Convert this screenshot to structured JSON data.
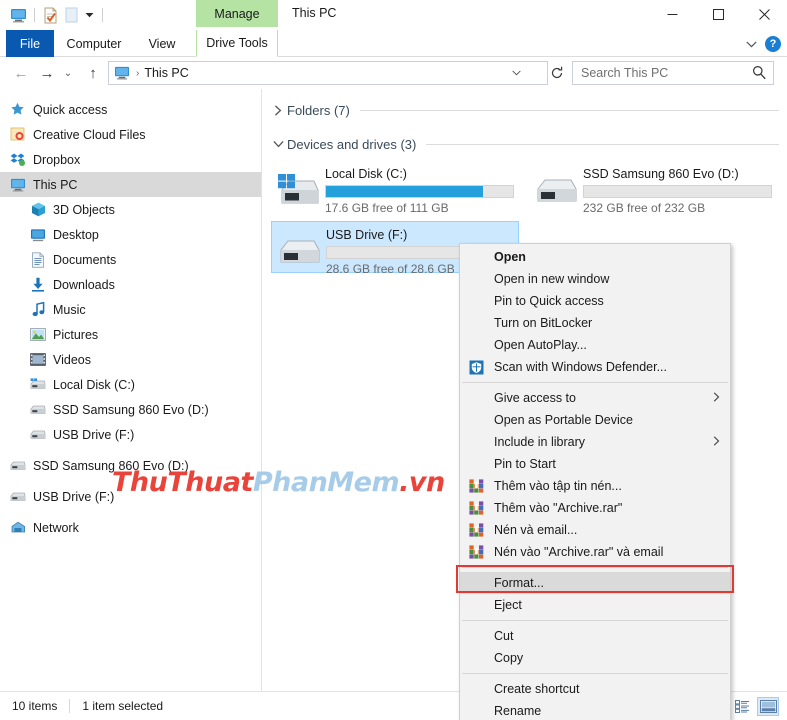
{
  "window": {
    "title": "This PC",
    "contextual_tab_group": "Manage",
    "quick_access_icons": [
      "this-pc-icon",
      "properties-icon",
      "new-folder-icon",
      "qat-dropdown-icon"
    ],
    "controls": {
      "minimize": "—",
      "maximize": "□",
      "close": "✕",
      "ribbon_toggle": "⌵",
      "help": "?"
    }
  },
  "ribbon": {
    "tabs": [
      {
        "label": "File",
        "active_style": "file"
      },
      {
        "label": "Computer",
        "active_style": "normal"
      },
      {
        "label": "View",
        "active_style": "normal"
      },
      {
        "label": "Drive Tools",
        "active_style": "contextual"
      }
    ]
  },
  "addressbar": {
    "back_icon": "←",
    "forward_icon": "→",
    "recent_icon": "⌄",
    "up_icon": "↑",
    "path_icon": "this-pc-icon",
    "path_separator": "›",
    "path_text": "This PC",
    "dropdown_icon": "⌄",
    "refresh_icon": "↻",
    "search_placeholder": "Search This PC",
    "search_value": "",
    "search_icon": "⌕"
  },
  "sidebar": {
    "items": [
      {
        "label": "Quick access",
        "icon": "star-pin-icon",
        "indent": 0,
        "selected": false
      },
      {
        "label": "Creative Cloud Files",
        "icon": "creative-cloud-icon",
        "indent": 0,
        "selected": false
      },
      {
        "label": "Dropbox",
        "icon": "dropbox-icon",
        "indent": 0,
        "selected": false
      },
      {
        "label": "This PC",
        "icon": "this-pc-icon",
        "indent": 0,
        "selected": true
      },
      {
        "label": "3D Objects",
        "icon": "3d-objects-icon",
        "indent": 1,
        "selected": false
      },
      {
        "label": "Desktop",
        "icon": "desktop-icon",
        "indent": 1,
        "selected": false
      },
      {
        "label": "Documents",
        "icon": "documents-icon",
        "indent": 1,
        "selected": false
      },
      {
        "label": "Downloads",
        "icon": "downloads-icon",
        "indent": 1,
        "selected": false
      },
      {
        "label": "Music",
        "icon": "music-icon",
        "indent": 1,
        "selected": false
      },
      {
        "label": "Pictures",
        "icon": "pictures-icon",
        "indent": 1,
        "selected": false
      },
      {
        "label": "Videos",
        "icon": "videos-icon",
        "indent": 1,
        "selected": false
      },
      {
        "label": "Local Disk (C:)",
        "icon": "windows-drive-icon",
        "indent": 1,
        "selected": false
      },
      {
        "label": "SSD Samsung 860 Evo (D:)",
        "icon": "drive-icon",
        "indent": 1,
        "selected": false
      },
      {
        "label": "USB Drive (F:)",
        "icon": "drive-icon",
        "indent": 1,
        "selected": false
      },
      {
        "label": "SSD Samsung 860 Evo (D:)",
        "icon": "drive-icon",
        "indent": 0,
        "selected": false
      },
      {
        "label": "USB Drive (F:)",
        "icon": "drive-icon",
        "indent": 0,
        "selected": false
      },
      {
        "label": "Network",
        "icon": "network-icon",
        "indent": 0,
        "selected": false
      }
    ]
  },
  "main": {
    "groups": [
      {
        "label": "Folders (7)",
        "expanded": false,
        "chevron": "›"
      },
      {
        "label": "Devices and drives (3)",
        "expanded": true,
        "chevron": "⌄"
      }
    ],
    "drives": [
      {
        "name": "Local Disk (C:)",
        "free_text": "17.6 GB free of 111 GB",
        "used_percent": 84,
        "icon": "windows-drive-icon",
        "selected": false,
        "show_bar_fill": true
      },
      {
        "name": "SSD Samsung 860 Evo (D:)",
        "free_text": "232 GB free of 232 GB",
        "used_percent": 0,
        "icon": "drive-icon",
        "selected": false,
        "show_bar_fill": false
      },
      {
        "name": "USB Drive (F:)",
        "free_text": "28.6 GB free of 28.6 GB",
        "used_percent": 0,
        "icon": "drive-icon",
        "selected": true,
        "show_bar_fill": false
      }
    ]
  },
  "context_menu": {
    "items": [
      {
        "label": "Open",
        "type": "item",
        "bold": true,
        "icon": null,
        "submenu": false
      },
      {
        "label": "Open in new window",
        "type": "item",
        "bold": false,
        "icon": null,
        "submenu": false
      },
      {
        "label": "Pin to Quick access",
        "type": "item",
        "bold": false,
        "icon": null,
        "submenu": false
      },
      {
        "label": "Turn on BitLocker",
        "type": "item",
        "bold": false,
        "icon": null,
        "submenu": false
      },
      {
        "label": "Open AutoPlay...",
        "type": "item",
        "bold": false,
        "icon": null,
        "submenu": false
      },
      {
        "label": "Scan with Windows Defender...",
        "type": "item",
        "bold": false,
        "icon": "defender-shield-icon",
        "submenu": false
      },
      {
        "type": "separator"
      },
      {
        "label": "Give access to",
        "type": "item",
        "bold": false,
        "icon": null,
        "submenu": true
      },
      {
        "label": "Open as Portable Device",
        "type": "item",
        "bold": false,
        "icon": null,
        "submenu": false
      },
      {
        "label": "Include in library",
        "type": "item",
        "bold": false,
        "icon": null,
        "submenu": true
      },
      {
        "label": "Pin to Start",
        "type": "item",
        "bold": false,
        "icon": null,
        "submenu": false
      },
      {
        "label": "Thêm vào tập tin nén...",
        "type": "item",
        "bold": false,
        "icon": "winrar-icon",
        "submenu": false
      },
      {
        "label": "Thêm vào \"Archive.rar\"",
        "type": "item",
        "bold": false,
        "icon": "winrar-icon",
        "submenu": false
      },
      {
        "label": "Nén và email...",
        "type": "item",
        "bold": false,
        "icon": "winrar-icon",
        "submenu": false
      },
      {
        "label": "Nén vào \"Archive.rar\" và email",
        "type": "item",
        "bold": false,
        "icon": "winrar-icon",
        "submenu": false
      },
      {
        "type": "separator"
      },
      {
        "label": "Format...",
        "type": "item",
        "bold": false,
        "icon": null,
        "submenu": false,
        "highlighted": true
      },
      {
        "label": "Eject",
        "type": "item",
        "bold": false,
        "icon": null,
        "submenu": false
      },
      {
        "type": "separator"
      },
      {
        "label": "Cut",
        "type": "item",
        "bold": false,
        "icon": null,
        "submenu": false
      },
      {
        "label": "Copy",
        "type": "item",
        "bold": false,
        "icon": null,
        "submenu": false
      },
      {
        "type": "separator"
      },
      {
        "label": "Create shortcut",
        "type": "item",
        "bold": false,
        "icon": null,
        "submenu": false
      },
      {
        "label": "Rename",
        "type": "item",
        "bold": false,
        "icon": null,
        "submenu": false
      }
    ],
    "highlight_color": "#e03a35"
  },
  "statusbar": {
    "item_count": "10 items",
    "selection": "1 item selected",
    "view_details_icon": "details-view-icon",
    "view_tiles_icon": "large-icons-view-icon"
  },
  "watermark": {
    "part1": "ThuThuat",
    "part2": "PhanMem",
    "part3": ".vn",
    "color1": "#e8342a",
    "color2": "#9fc8e8",
    "color3": "#e8342a"
  }
}
